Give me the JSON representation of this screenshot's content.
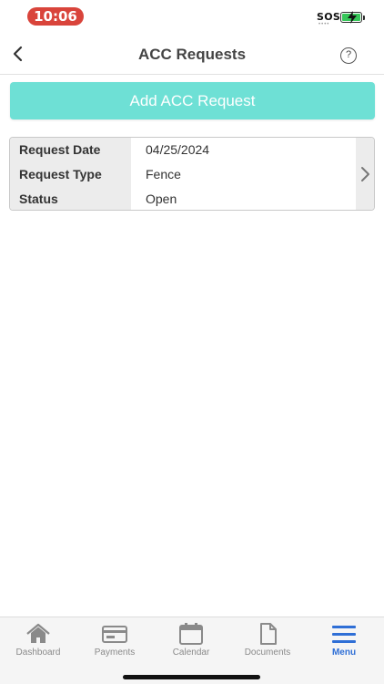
{
  "status_bar": {
    "time": "10:06",
    "carrier_text": "SOS",
    "battery_color": "#36c759",
    "time_pill_color": "#d9443b"
  },
  "header": {
    "title": "ACC Requests",
    "back_icon": "chevron-left-icon",
    "help_icon": "question-circle-icon",
    "help_glyph": "?"
  },
  "actions": {
    "add_label": "Add ACC Request",
    "add_color": "#6ee0d5"
  },
  "requests": [
    {
      "fields": [
        {
          "label": "Request Date",
          "value": "04/25/2024"
        },
        {
          "label": "Request Type",
          "value": "Fence"
        },
        {
          "label": "Status",
          "value": "Open"
        }
      ]
    }
  ],
  "tab_bar": {
    "active_color": "#2f6fd6",
    "items": [
      {
        "label": "Dashboard",
        "icon": "home-icon",
        "active": false
      },
      {
        "label": "Payments",
        "icon": "credit-card-icon",
        "active": false
      },
      {
        "label": "Calendar",
        "icon": "calendar-icon",
        "active": false
      },
      {
        "label": "Documents",
        "icon": "document-icon",
        "active": false
      },
      {
        "label": "Menu",
        "icon": "hamburger-menu-icon",
        "active": true
      }
    ]
  }
}
